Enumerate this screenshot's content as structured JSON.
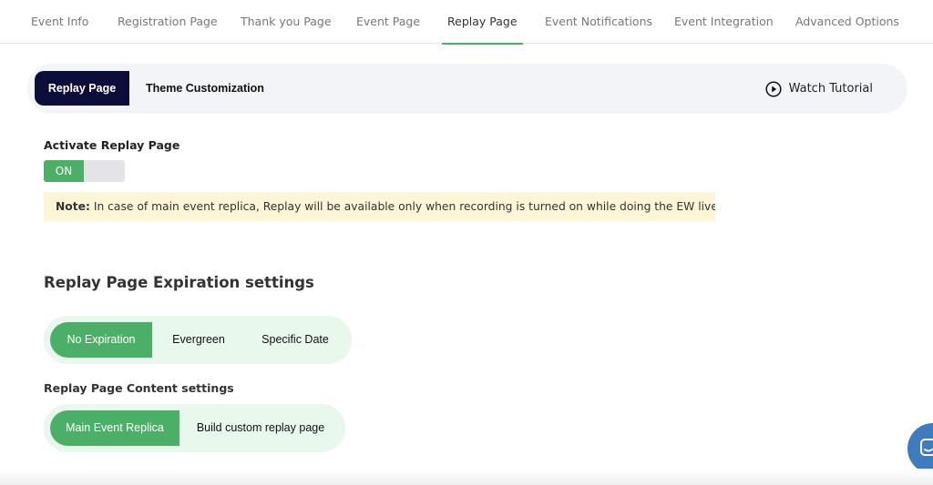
{
  "top_nav": {
    "tabs": [
      {
        "label": "Event Info",
        "active": false
      },
      {
        "label": "Registration Page",
        "active": false
      },
      {
        "label": "Thank you Page",
        "active": false
      },
      {
        "label": "Event Page",
        "active": false
      },
      {
        "label": "Replay Page",
        "active": true
      },
      {
        "label": "Event Notifications",
        "active": false
      },
      {
        "label": "Event Integration",
        "active": false
      },
      {
        "label": "Advanced Options",
        "active": false
      }
    ],
    "accent_color": "#4caf67"
  },
  "sub_bar": {
    "tabs": [
      {
        "label": "Replay Page",
        "active": true
      },
      {
        "label": "Theme Customization",
        "active": false
      }
    ],
    "active_color": "#0d0d3b",
    "watch_tutorial": {
      "label": "Watch Tutorial",
      "icon": "play-circle-icon"
    }
  },
  "activate": {
    "label": "Activate Replay Page",
    "toggle_on_label": "ON",
    "toggle_state": "on"
  },
  "note": {
    "prefix": "Note:",
    "text": "In case of main event replica, Replay will be available only when recording is turned on while doing the EW live event."
  },
  "expiration": {
    "title": "Replay Page Expiration settings",
    "options": [
      {
        "label": "No Expiration",
        "active": true
      },
      {
        "label": "Evergreen",
        "active": false
      },
      {
        "label": "Specific Date",
        "active": false
      }
    ]
  },
  "content": {
    "title": "Replay Page Content settings",
    "options": [
      {
        "label": "Main Event Replica",
        "active": true
      },
      {
        "label": "Build custom replay page",
        "active": false
      }
    ]
  },
  "chat_widget": {
    "icon": "chat-icon",
    "color": "#3f7bbf"
  }
}
